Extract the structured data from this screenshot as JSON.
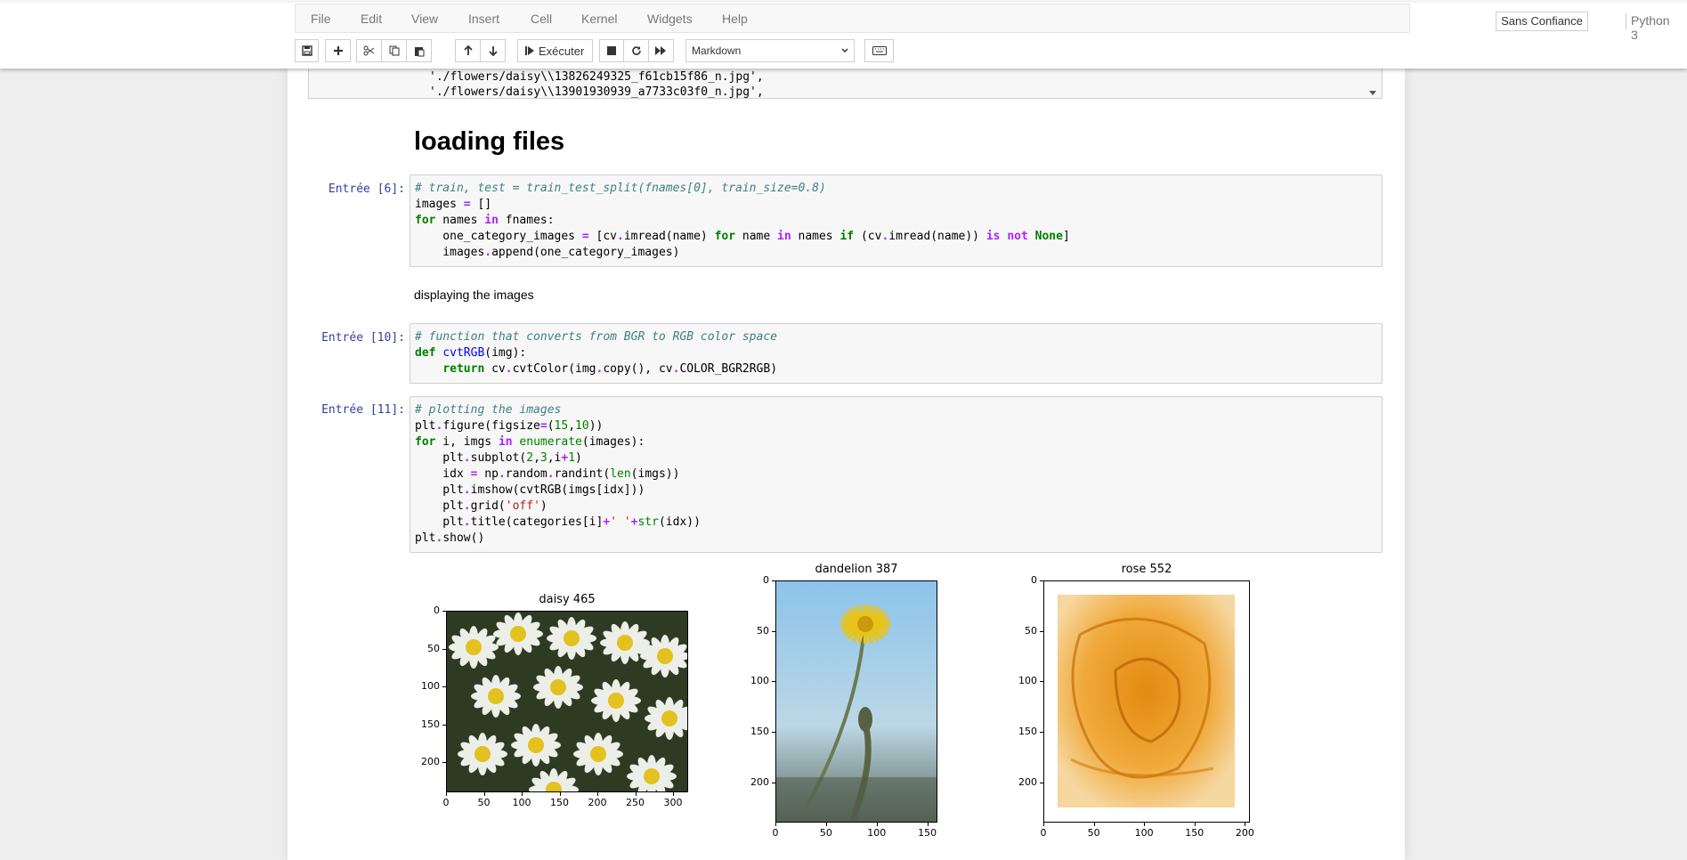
{
  "menu": {
    "items": [
      "File",
      "Edit",
      "View",
      "Insert",
      "Cell",
      "Kernel",
      "Widgets",
      "Help"
    ],
    "trust": "Sans Confiance",
    "kernel": "Python 3"
  },
  "toolbar": {
    "run_label": "Exécuter",
    "cell_type": "Markdown"
  },
  "output_top": {
    "lines": [
      "'./flowers/daisy\\\\13826249325_f61cb15f86_n.jpg',",
      "'./flowers/daisy\\\\13901930939_a7733c03f0_n.jpg',"
    ]
  },
  "markdown": {
    "heading": "loading files",
    "paragraph": "displaying the images"
  },
  "cells": [
    {
      "prompt": "Entrée [6]:"
    },
    {
      "prompt": "Entrée [10]:"
    },
    {
      "prompt": "Entrée [11]:"
    }
  ],
  "chart_data": [
    {
      "type": "image",
      "title": "daisy 465",
      "xticks": [
        "0",
        "50",
        "100",
        "150",
        "200",
        "250",
        "300"
      ],
      "yticks": [
        "0",
        "50",
        "100",
        "150",
        "200"
      ],
      "xlim": [
        0,
        320
      ],
      "ylim": [
        240,
        0
      ]
    },
    {
      "type": "image",
      "title": "dandelion 387",
      "xticks": [
        "0",
        "50",
        "100",
        "150"
      ],
      "yticks": [
        "0",
        "50",
        "100",
        "150",
        "200"
      ],
      "xlim": [
        0,
        160
      ],
      "ylim": [
        240,
        0
      ]
    },
    {
      "type": "image",
      "title": "rose 552",
      "xticks": [
        "0",
        "50",
        "100",
        "150",
        "200"
      ],
      "yticks": [
        "0",
        "50",
        "100",
        "150",
        "200"
      ],
      "xlim": [
        0,
        205
      ],
      "ylim": [
        240,
        0
      ]
    }
  ],
  "colors": {
    "prompt": "#303f9f",
    "comment": "#408080",
    "keyword": "#008000",
    "operator": "#aa22ff",
    "string": "#ba2121"
  }
}
